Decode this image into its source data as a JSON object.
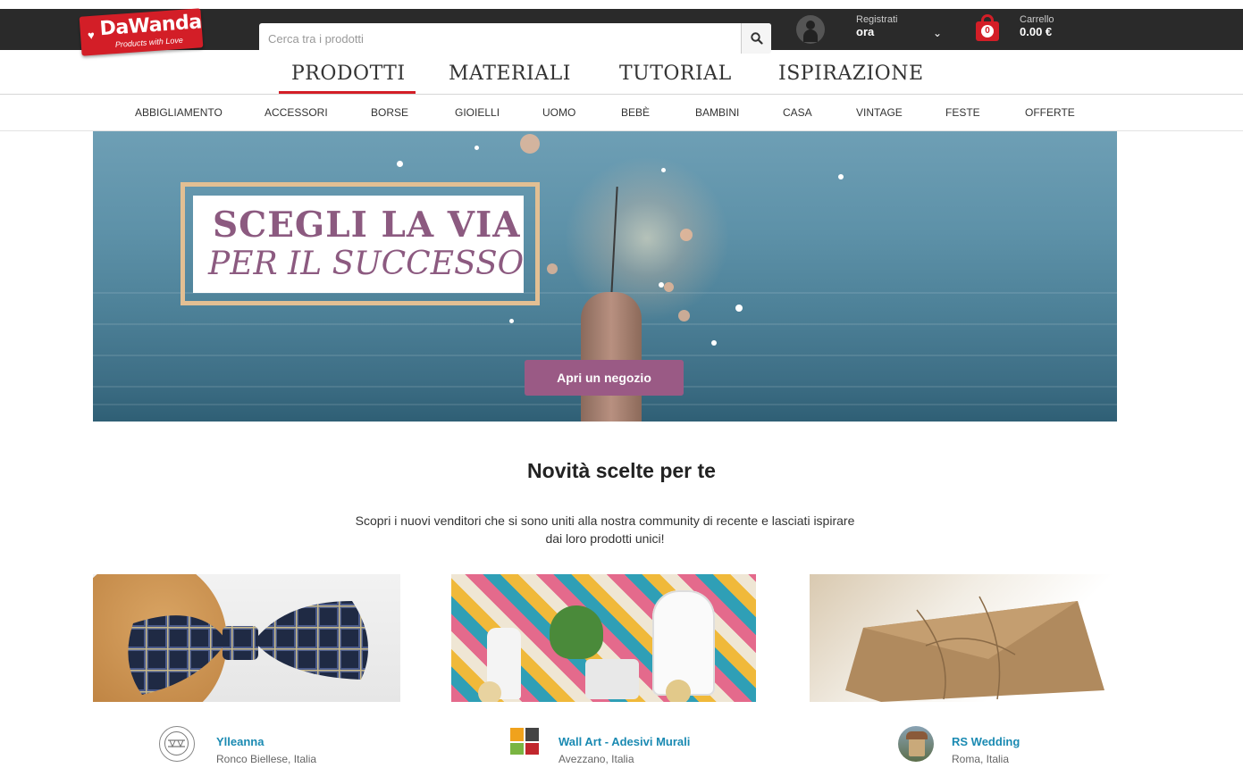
{
  "brand": {
    "name": "DaWanda",
    "tagline": "Products with Love",
    "color": "#d31e27"
  },
  "search": {
    "placeholder": "Cerca tra i prodotti"
  },
  "account": {
    "line1": "Registrati",
    "line2": "ora"
  },
  "cart": {
    "label": "Carrello",
    "total": "0.00 €",
    "count": "0"
  },
  "main_nav": [
    "PRODOTTI",
    "MATERIALI",
    "TUTORIAL",
    "ISPIRAZIONE"
  ],
  "sub_nav": [
    "ABBIGLIAMENTO",
    "ACCESSORI",
    "BORSE",
    "GIOIELLI",
    "UOMO",
    "BEBÈ",
    "BAMBINI",
    "CASA",
    "VINTAGE",
    "FESTE",
    "OFFERTE"
  ],
  "hero": {
    "line1": "SCEGLI LA VIA",
    "line2": "PER IL SUCCESSO",
    "button": "Apri un negozio"
  },
  "section": {
    "title": "Novità scelte per te",
    "description": "Scopri i nuovi venditori che si sono uniti alla nostra community di recente e lasciati ispirare dai loro prodotti unici!"
  },
  "shops": [
    {
      "name": "Ylleanna",
      "location": "Ronco Biellese, Italia"
    },
    {
      "name": "Wall Art - Adesivi Murali",
      "location": "Avezzano, Italia"
    },
    {
      "name": "RS Wedding",
      "location": "Roma, Italia"
    }
  ]
}
